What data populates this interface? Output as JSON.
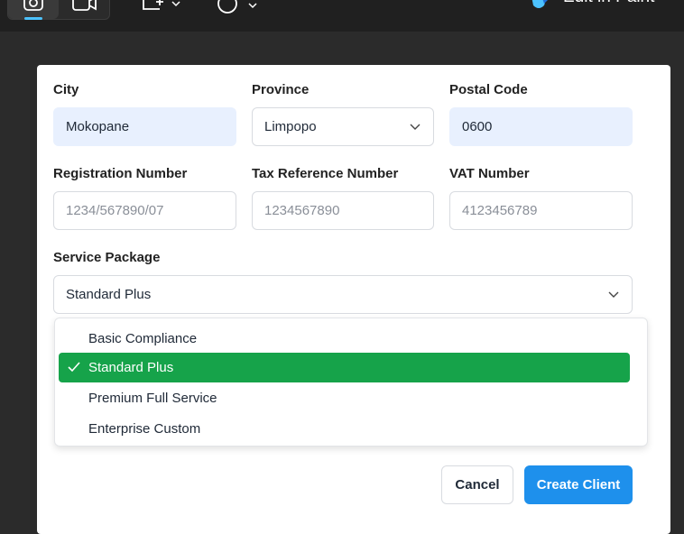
{
  "toolbar": {
    "paint_label": "Edit in Paint"
  },
  "form": {
    "city": {
      "label": "City",
      "value": "Mokopane"
    },
    "province": {
      "label": "Province",
      "value": "Limpopo"
    },
    "postal_code": {
      "label": "Postal Code",
      "value": "0600"
    },
    "registration_number": {
      "label": "Registration Number",
      "placeholder": "1234/567890/07"
    },
    "tax_reference_number": {
      "label": "Tax Reference Number",
      "placeholder": "1234567890"
    },
    "vat_number": {
      "label": "VAT Number",
      "placeholder": "4123456789"
    },
    "service_package": {
      "label": "Service Package",
      "value": "Standard Plus",
      "options": [
        {
          "label": "Basic Compliance",
          "selected": false
        },
        {
          "label": "Standard Plus",
          "selected": true
        },
        {
          "label": "Premium Full Service",
          "selected": false
        },
        {
          "label": "Enterprise Custom",
          "selected": false
        }
      ]
    }
  },
  "actions": {
    "cancel_label": "Cancel",
    "create_label": "Create Client"
  },
  "colors": {
    "accent": "#1e90ec",
    "selected_option": "#16a34a",
    "filled_input": "#e8f0fe"
  }
}
